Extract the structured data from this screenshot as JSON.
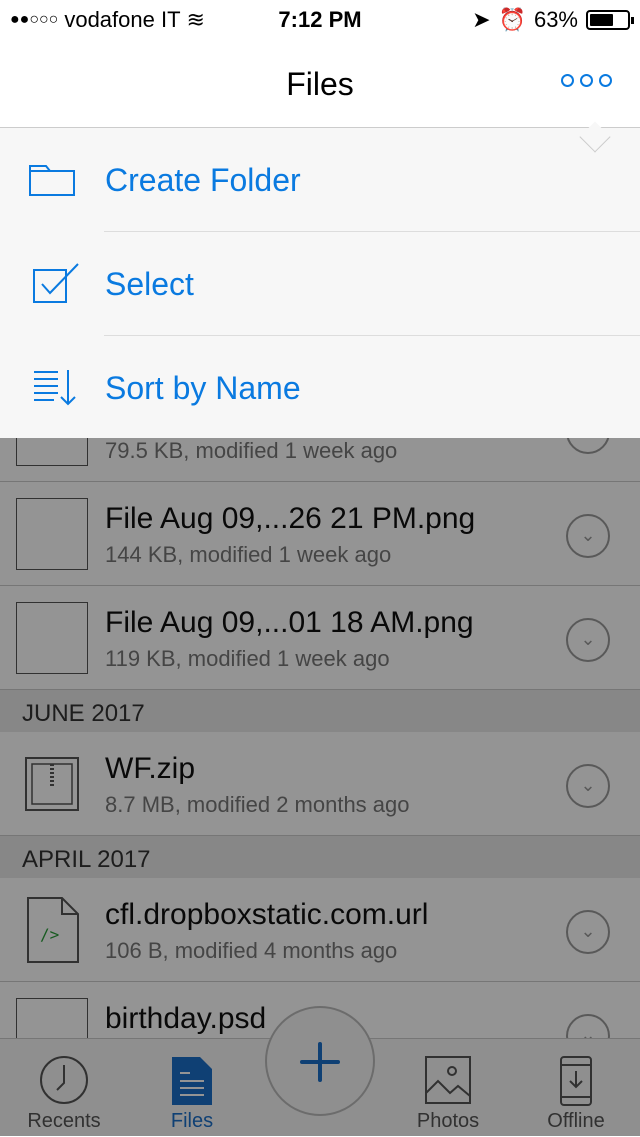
{
  "status": {
    "signal": "●●○○○",
    "carrier": "vodafone IT",
    "time": "7:12 PM",
    "battery": "63%",
    "battery_level": 0.63
  },
  "nav": {
    "title": "Files",
    "more_icon": "ellipsis-icon"
  },
  "menu": [
    {
      "label": "Create Folder",
      "icon": "folder-icon"
    },
    {
      "label": "Select",
      "icon": "checkbox-icon"
    },
    {
      "label": "Sort by Name",
      "icon": "sort-icon"
    }
  ],
  "files": [
    {
      "name": "",
      "meta": "79.5 KB, modified 1 week ago"
    },
    {
      "name": "File Aug 09,...26 21 PM.png",
      "meta": "144 KB, modified 1 week ago"
    },
    {
      "name": "File Aug 09,...01 18 AM.png",
      "meta": "119 KB, modified 1 week ago"
    },
    {
      "name": "WF.zip",
      "meta": "8.7 MB, modified 2 months ago"
    },
    {
      "name": "cfl.dropboxstatic.com.url",
      "meta": "106 B, modified 4 months ago"
    },
    {
      "name": "birthday.psd",
      "meta": ""
    }
  ],
  "sections": [
    "JUNE 2017",
    "APRIL 2017"
  ],
  "tabs": [
    {
      "label": "Recents"
    },
    {
      "label": "Files",
      "active": true
    },
    {
      "label": "Photos"
    },
    {
      "label": "Offline"
    }
  ],
  "colors": {
    "accent": "#0a7ae0",
    "active_tab": "#1a6fc9"
  }
}
